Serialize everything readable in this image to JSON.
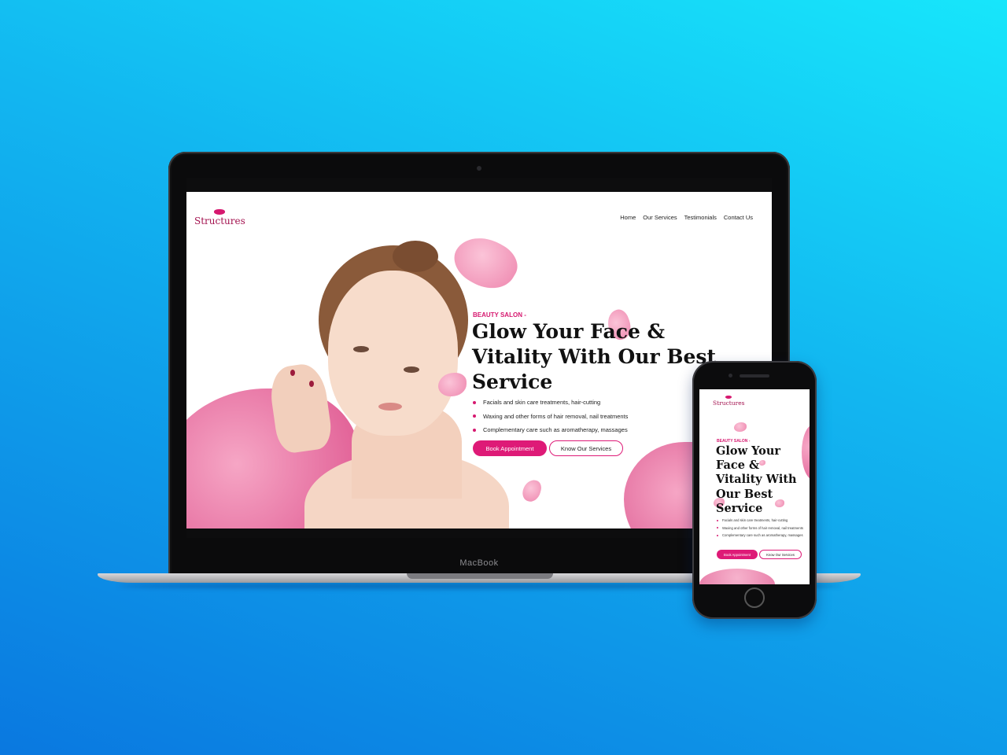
{
  "laptop": {
    "brand": "MacBook",
    "site": {
      "logo": "Structures",
      "nav": [
        "Home",
        "Our Services",
        "Testimonials",
        "Contact Us"
      ],
      "hero": {
        "kicker": "BEAUTY SALON -",
        "title": "Glow Your Face & Vitality With Our Best Service",
        "bullets": [
          "Facials and skin care treatments, hair-cutting",
          "Waxing and other forms of hair removal, nail treatments",
          "Complementary care such as aromatherapy, massages"
        ],
        "primary_button": "Book Appointment",
        "secondary_button": "Know Our Services"
      }
    }
  },
  "phone": {
    "site": {
      "logo": "Structures",
      "hero": {
        "kicker": "BEAUTY SALON -",
        "title": "Glow Your Face & Vitality With Our Best Service",
        "bullets": [
          "Facials and skin care treatments, hair-cutting",
          "Waxing and other forms of hair removal, nail treatments",
          "Complementary care such as aromatherapy, massages"
        ],
        "primary_button": "Book Appointment",
        "secondary_button": "Know Our Services"
      }
    }
  },
  "colors": {
    "accent": "#de1a77",
    "logo": "#a3124f",
    "background_top": "#17e6fb",
    "background_bottom": "#0a78e0"
  },
  "icons": [
    "lips-logo-icon",
    "bullet-dot-icon",
    "webcam-icon",
    "home-button-icon"
  ]
}
